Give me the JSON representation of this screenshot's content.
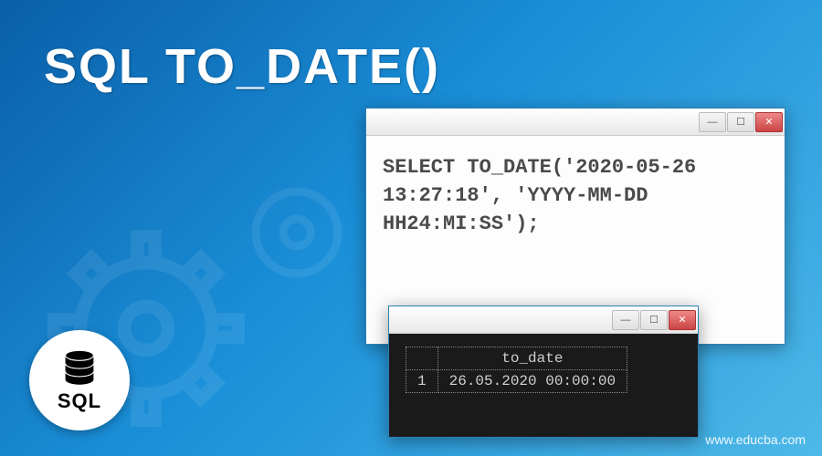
{
  "title": "SQL TO_DATE()",
  "editor": {
    "code": "SELECT TO_DATE('2020-05-26 13:27:18', 'YYYY-MM-DD HH24:MI:SS');"
  },
  "result": {
    "column_header": "to_date",
    "row_index": "1",
    "row_value": "26.05.2020 00:00:00"
  },
  "badge": {
    "label": "SQL"
  },
  "watermark": "www.educba.com",
  "window_buttons": {
    "minimize": "—",
    "maximize": "☐",
    "close": "✕"
  }
}
